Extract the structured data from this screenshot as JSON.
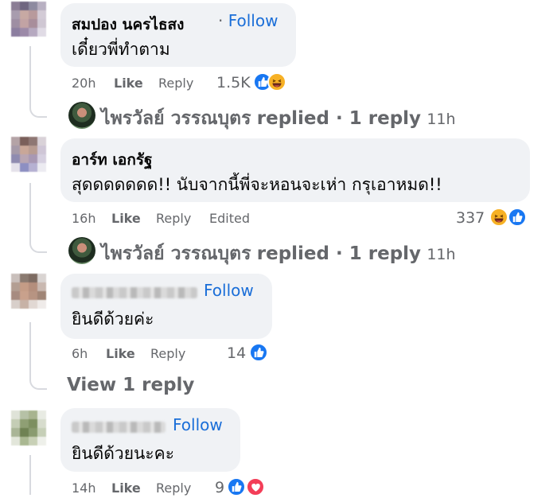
{
  "comments": [
    {
      "name": "สมปอง นครไธสง",
      "name_blurred": false,
      "follow": "Follow",
      "text": "เดี๋ยวพี่ทำตาม",
      "time": "20h",
      "like": "Like",
      "reply": "Reply",
      "edited": "",
      "reaction_count": "1.5K",
      "reactions": [
        "like",
        "haha"
      ]
    },
    {
      "name": "อาร์ท เอกรัฐ",
      "name_blurred": false,
      "follow": "",
      "text": "สุดดดดดดด!! นับจากนี้พี่จะหอนจะเห่า กรุเอาหมด!!",
      "time": "16h",
      "like": "Like",
      "reply": "Reply",
      "edited": "Edited",
      "reaction_count": "337",
      "reactions": [
        "haha",
        "like"
      ]
    },
    {
      "name": "",
      "name_blurred": true,
      "follow": "Follow",
      "text": "ยินดีด้วยค่ะ",
      "time": "6h",
      "like": "Like",
      "reply": "Reply",
      "edited": "",
      "reaction_count": "14",
      "reactions": [
        "like"
      ]
    },
    {
      "name": "",
      "name_blurred": true,
      "follow": "Follow",
      "text": "ยินดีด้วยนะคะ",
      "time": "14h",
      "like": "Like",
      "reply": "Reply",
      "edited": "",
      "reaction_count": "9",
      "reactions": [
        "like",
        "love"
      ]
    }
  ],
  "replied_rows": [
    {
      "who": "ไพรวัลย์ วรรณบุตร",
      "text": "replied · 1 reply",
      "time": "11h"
    },
    {
      "who": "ไพรวัลย์ วรรณบุตร",
      "text": "replied · 1 reply",
      "time": "11h"
    }
  ],
  "view_reply": "View 1 reply",
  "colors": {
    "follow": "#1a6ed8",
    "bubble": "#f0f2f5",
    "meta": "#65676b",
    "like": "#1877f2",
    "haha": "#f7b125",
    "love": "#f33e58"
  },
  "icons": {
    "like": "like-reaction-icon",
    "haha": "haha-reaction-icon",
    "love": "love-reaction-icon"
  }
}
